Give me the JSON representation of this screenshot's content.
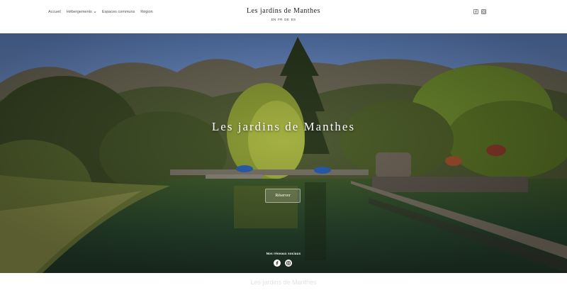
{
  "header": {
    "nav": [
      {
        "label": "Accueil"
      },
      {
        "label": "Hébergements"
      },
      {
        "label": "Espaces communs"
      },
      {
        "label": "Région"
      }
    ],
    "site_title": "Les jardins de Manthes",
    "languages": [
      "EN",
      "FR",
      "DE",
      "ES"
    ],
    "social_icons": [
      "facebook-icon",
      "instagram-icon"
    ]
  },
  "hero": {
    "title": "Les jardins de Manthes",
    "reserve_label": "Réserver",
    "social_label": "Nos réseaux sociaux",
    "social_icons": [
      "facebook-icon",
      "instagram-icon"
    ]
  },
  "footer": {
    "title": "Les jardins de Manthes"
  },
  "colors": {
    "sky": "#6f8fc4",
    "foliage": "#3a4a22",
    "water": "#2f4a33",
    "deck": "#6b6256"
  }
}
